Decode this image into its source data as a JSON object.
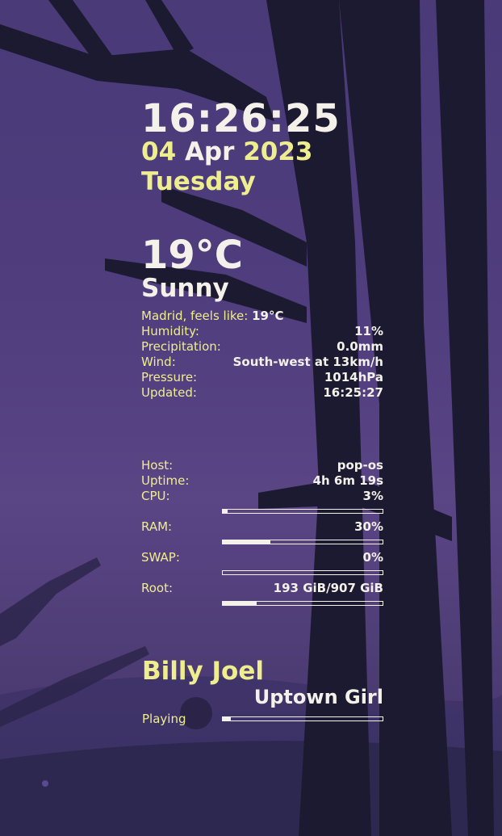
{
  "clock": {
    "time": "16:26:25",
    "day": "04",
    "month": "Apr",
    "year": "2023",
    "weekday": "Tuesday"
  },
  "weather": {
    "temperature": "19°C",
    "condition": "Sunny",
    "location_label": "Madrid, feels like:",
    "feels_like": "19°C",
    "humidity_label": "Humidity:",
    "humidity": "11%",
    "precipitation_label": "Precipitation:",
    "precipitation": "0.0mm",
    "wind_label": "Wind:",
    "wind": "South-west at 13km/h",
    "pressure_label": "Pressure:",
    "pressure": "1014hPa",
    "updated_label": "Updated:",
    "updated": "16:25:27"
  },
  "system": {
    "host_label": "Host:",
    "host": "pop-os",
    "uptime_label": "Uptime:",
    "uptime": "4h 6m 19s",
    "cpu_label": "CPU:",
    "cpu": "3%",
    "cpu_fraction": 0.03,
    "ram_label": "RAM:",
    "ram": "30%",
    "ram_fraction": 0.3,
    "swap_label": "SWAP:",
    "swap": "0%",
    "swap_fraction": 0.0,
    "root_label": "Root:",
    "root": "193 GiB/907 GiB",
    "root_fraction": 0.21
  },
  "music": {
    "artist": "Billy Joel",
    "title": "Uptown Girl",
    "status": "Playing",
    "progress_fraction": 0.05
  },
  "colors": {
    "accent": "#eeee8e",
    "text": "#f4f1ea",
    "tree": "#1c1a30"
  }
}
